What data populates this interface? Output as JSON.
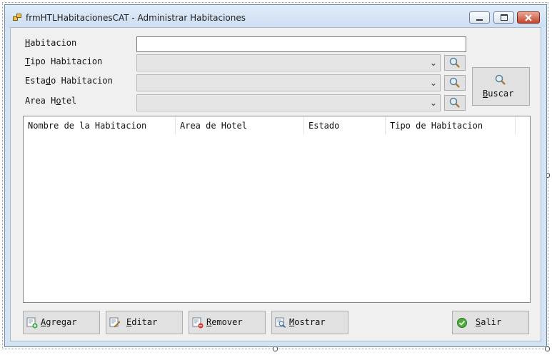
{
  "window": {
    "title": "frmHTLHabitacionesCAT - Administrar Habitaciones"
  },
  "form": {
    "habitacion": {
      "label_access": "H",
      "label_rest": "abitacion",
      "value": ""
    },
    "tipo": {
      "label_access": "T",
      "label_rest": "ipo Habitacion",
      "value": ""
    },
    "estado": {
      "label_pre": "Esta",
      "label_access": "d",
      "label_rest": "o Habitacion",
      "value": ""
    },
    "area": {
      "label_pre": "Area H",
      "label_access": "o",
      "label_rest": "tel",
      "value": ""
    }
  },
  "buscar": {
    "access": "B",
    "rest": "uscar"
  },
  "table": {
    "columns": [
      "Nombre de la Habitacion",
      "Area de Hotel",
      "Estado",
      "Tipo de Habitacion"
    ],
    "rows": []
  },
  "buttons": {
    "agregar": {
      "access": "A",
      "rest": "gregar"
    },
    "editar": {
      "access": "E",
      "rest": "ditar"
    },
    "remover": {
      "access": "R",
      "rest": "emover"
    },
    "mostrar": {
      "access": "M",
      "rest": "ostrar"
    },
    "salir": {
      "access": "S",
      "rest": "alir"
    }
  },
  "icons": {
    "search": "magnifier-icon",
    "add": "add-document-icon",
    "edit": "edit-document-icon",
    "remove": "remove-document-icon",
    "show": "view-document-icon",
    "exit": "check-icon"
  },
  "colors": {
    "titlebar": "#cddff2",
    "client": "#f0f0f0",
    "button": "#e1e1e1",
    "close": "#c5452e"
  }
}
